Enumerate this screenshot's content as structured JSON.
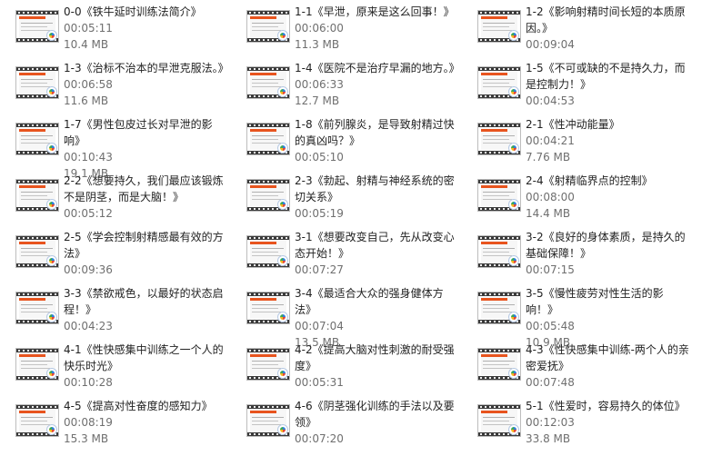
{
  "files": [
    {
      "title": "0-0《铁牛延时训练法简介》",
      "duration": "00:05:11",
      "size": "10.4 MB"
    },
    {
      "title": "1-1《早泄，原来是这么回事！》",
      "duration": "00:06:00",
      "size": "11.3 MB"
    },
    {
      "title": "1-2《影响射精时间长短的本质原因。》",
      "duration": "00:09:04",
      "size": ""
    },
    {
      "title": "1-3《治标不治本的早泄克服法。》",
      "duration": "00:06:58",
      "size": "11.6 MB"
    },
    {
      "title": "1-4《医院不是治疗早漏的地方。》",
      "duration": "00:06:33",
      "size": "12.7 MB"
    },
    {
      "title": "1-5《不可或缺的不是持久力，而是控制力！》",
      "duration": "00:04:53",
      "size": ""
    },
    {
      "title": "1-7《男性包皮过长对早泄的影响》",
      "duration": "00:10:43",
      "size": "19.1 MB"
    },
    {
      "title": "1-8《前列腺炎，是导致射精过快的真凶吗？》",
      "duration": "00:05:10",
      "size": ""
    },
    {
      "title": "2-1《性冲动能量》",
      "duration": "00:04:21",
      "size": "7.76 MB"
    },
    {
      "title": "2-2《想要持久，我们最应该锻炼不是阴茎，而是大脑！》",
      "duration": "00:05:12",
      "size": ""
    },
    {
      "title": "2-3《勃起、射精与神经系统的密切关系》",
      "duration": "00:05:19",
      "size": ""
    },
    {
      "title": "2-4《射精临界点的控制》",
      "duration": "00:08:00",
      "size": "14.4 MB"
    },
    {
      "title": "2-5《学会控制射精感最有效的方法》",
      "duration": "00:09:36",
      "size": ""
    },
    {
      "title": "3-1《想要改变自己，先从改变心态开始！》",
      "duration": "00:07:27",
      "size": ""
    },
    {
      "title": "3-2《良好的身体素质，是持久的基础保障！》",
      "duration": "00:07:15",
      "size": ""
    },
    {
      "title": "3-3《禁欲戒色，以最好的状态启程！》",
      "duration": "00:04:23",
      "size": ""
    },
    {
      "title": "3-4《最适合大众的强身健体方法》",
      "duration": "00:07:04",
      "size": "13.5 MB"
    },
    {
      "title": "3-5《慢性疲劳对性生活的影响！》",
      "duration": "00:05:48",
      "size": "10.9 MB"
    },
    {
      "title": "4-1《性快感集中训练之一个人的快乐时光》",
      "duration": "00:10:28",
      "size": ""
    },
    {
      "title": "4-2《提高大脑对性刺激的耐受强度》",
      "duration": "00:05:31",
      "size": ""
    },
    {
      "title": "4-3《性快感集中训练-两个人的亲密爱抚》",
      "duration": "00:07:48",
      "size": ""
    },
    {
      "title": "4-5《提高对性奋度的感知力》",
      "duration": "00:08:19",
      "size": "15.3 MB"
    },
    {
      "title": "4-6《阴茎强化训练的手法以及要领》",
      "duration": "00:07:20",
      "size": ""
    },
    {
      "title": "5-1《性爱时，容易持久的体位》",
      "duration": "00:12:03",
      "size": "33.8 MB"
    }
  ],
  "icons": {
    "thumbnail": "video-thumbnail-icon",
    "badge": "media-player-badge-icon"
  },
  "colors": {
    "accent_bar": "#e8541e",
    "meta_text": "#6f6f6f"
  }
}
